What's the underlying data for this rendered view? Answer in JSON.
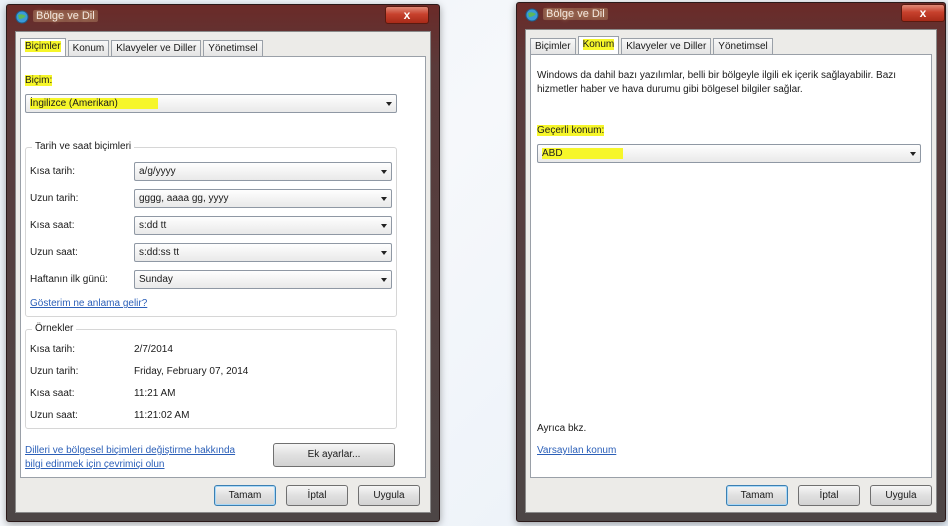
{
  "left_window": {
    "title": "Bölge ve Dil",
    "close": "x",
    "tabs": [
      "Biçimler",
      "Konum",
      "Klavyeler ve Diller",
      "Yönetimsel"
    ],
    "active_tab": "Biçimler",
    "format_label": "Biçim:",
    "format_value": "İngilizce (Amerikan)",
    "date_time_group": "Tarih ve saat biçimleri",
    "rows": [
      {
        "label": "Kısa tarih:",
        "value": "a/g/yyyy"
      },
      {
        "label": "Uzun tarih:",
        "value": "gggg, aaaa gg, yyyy"
      },
      {
        "label": "Kısa saat:",
        "value": "s:dd tt"
      },
      {
        "label": "Uzun saat:",
        "value": "s:dd:ss tt"
      },
      {
        "label": "Haftanın ilk günü:",
        "value": "Sunday"
      }
    ],
    "notation_link": "Gösterim ne anlama gelir?",
    "examples_group": "Örnekler",
    "examples": [
      {
        "label": "Kısa tarih:",
        "value": "2/7/2014"
      },
      {
        "label": "Uzun tarih:",
        "value": "Friday, February 07, 2014"
      },
      {
        "label": "Kısa saat:",
        "value": "11:21 AM"
      },
      {
        "label": "Uzun saat:",
        "value": "11:21:02 AM"
      }
    ],
    "online_link_line1": "Dilleri ve bölgesel biçimleri değiştirme hakkında",
    "online_link_line2": "bilgi edinmek için çevrimiçi olun",
    "extra_settings": "Ek ayarlar...",
    "ok": "Tamam",
    "cancel": "İptal",
    "apply": "Uygula"
  },
  "right_window": {
    "title": "Bölge ve Dil",
    "close": "x",
    "tabs": [
      "Biçimler",
      "Konum",
      "Klavyeler ve Diller",
      "Yönetimsel"
    ],
    "active_tab": "Konum",
    "description_line1": "Windows da dahil bazı yazılımlar, belli bir bölgeyle ilgili ek içerik sağlayabilir. Bazı",
    "description_line2": "hizmetler haber ve hava durumu gibi bölgesel bilgiler sağlar.",
    "current_location_label": "Geçerli konum:",
    "current_location_value": "ABD",
    "see_also": "Ayrıca bkz.",
    "default_location_link": "Varsayılan konum",
    "ok": "Tamam",
    "cancel": "İptal",
    "apply": "Uygula"
  },
  "colors": {
    "highlight": "#f6f62a",
    "link": "#2b5fb8",
    "close_button": "#c7412d"
  }
}
